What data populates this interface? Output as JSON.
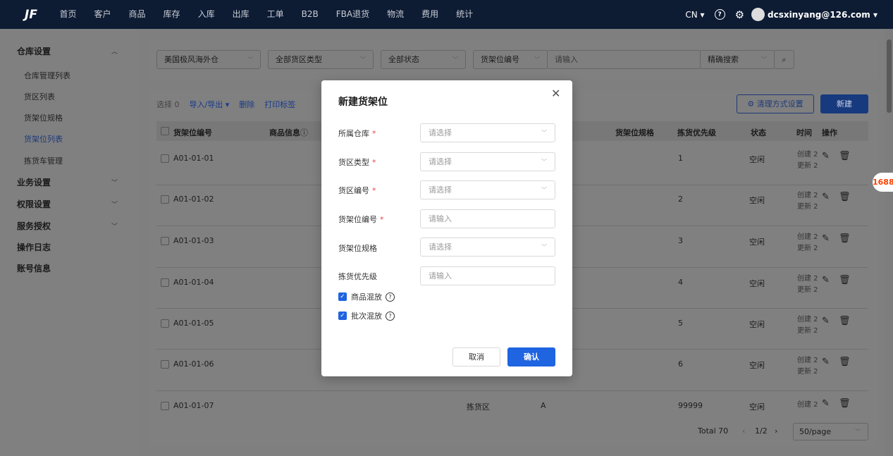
{
  "topbar": {
    "logo_text": "JF",
    "nav": [
      "首页",
      "客户",
      "商品",
      "库存",
      "入库",
      "出库",
      "工单",
      "B2B",
      "FBA退货",
      "物流",
      "费用",
      "统计"
    ],
    "lang": "CN ▾",
    "help_icon": "?",
    "settings_icon": "⚙",
    "user": "dcsxinyang@126.com ▾"
  },
  "sidebar": {
    "group_warehouse": "仓库设置",
    "items": [
      "仓库管理列表",
      "货区列表",
      "货架位规格",
      "货架位列表",
      "拣货车管理"
    ],
    "group_business": "业务设置",
    "group_permission": "权限设置",
    "group_service": "服务授权",
    "group_log": "操作日志",
    "group_account": "账号信息"
  },
  "filters": {
    "warehouse": "美国极风海外仓",
    "zone_type": "全部货区类型",
    "status": "全部状态",
    "field": "货架位编号",
    "search_placeholder": "请输入",
    "match": "精确搜索"
  },
  "toolbar": {
    "selected": "选择 0",
    "import_export": "导入/导出 ▾",
    "delete": "删除",
    "print": "打印标签",
    "clear_setting": "清理方式设置",
    "new": "新建"
  },
  "table": {
    "headers": [
      "货架位编号",
      "商品信息",
      "货架位规格",
      "拣货优先级",
      "状态",
      "时间",
      "操作"
    ],
    "rows": [
      {
        "code": "A01-01-01",
        "priority": "1",
        "status": "空闲",
        "created": "创建 2",
        "updated": "更新 2"
      },
      {
        "code": "A01-01-02",
        "priority": "2",
        "status": "空闲",
        "created": "创建 2",
        "updated": "更新 2"
      },
      {
        "code": "A01-01-03",
        "priority": "3",
        "status": "空闲",
        "created": "创建 2",
        "updated": "更新 2"
      },
      {
        "code": "A01-01-04",
        "priority": "4",
        "status": "空闲",
        "created": "创建 2",
        "updated": "更新 2"
      },
      {
        "code": "A01-01-05",
        "priority": "5",
        "status": "空闲",
        "created": "创建 2",
        "updated": "更新 2"
      },
      {
        "code": "A01-01-06",
        "priority": "6",
        "status": "空闲",
        "created": "创建 2",
        "updated": "更新 2"
      },
      {
        "code": "A01-01-07",
        "zone": "拣货区",
        "zone_code": "A",
        "priority": "99999",
        "status": "空闲",
        "created": "创建 2",
        "updated": ""
      }
    ]
  },
  "pager": {
    "total": "Total 70",
    "page": "1/2",
    "page_size": "50/page"
  },
  "float_badge": "1688",
  "modal": {
    "title": "新建货架位",
    "fields": [
      {
        "label": "所属仓库",
        "required": true,
        "placeholder": "请选择",
        "type": "select"
      },
      {
        "label": "货区类型",
        "required": true,
        "placeholder": "请选择",
        "type": "select"
      },
      {
        "label": "货区编号",
        "required": true,
        "placeholder": "请选择",
        "type": "select"
      },
      {
        "label": "货架位编号",
        "required": true,
        "placeholder": "请输入",
        "type": "input"
      },
      {
        "label": "货架位规格",
        "required": false,
        "placeholder": "请选择",
        "type": "select"
      },
      {
        "label": "拣货优先级",
        "required": false,
        "placeholder": "请输入",
        "type": "input"
      }
    ],
    "checks": [
      "商品混放",
      "批次混放"
    ],
    "cancel": "取消",
    "confirm": "确认"
  }
}
